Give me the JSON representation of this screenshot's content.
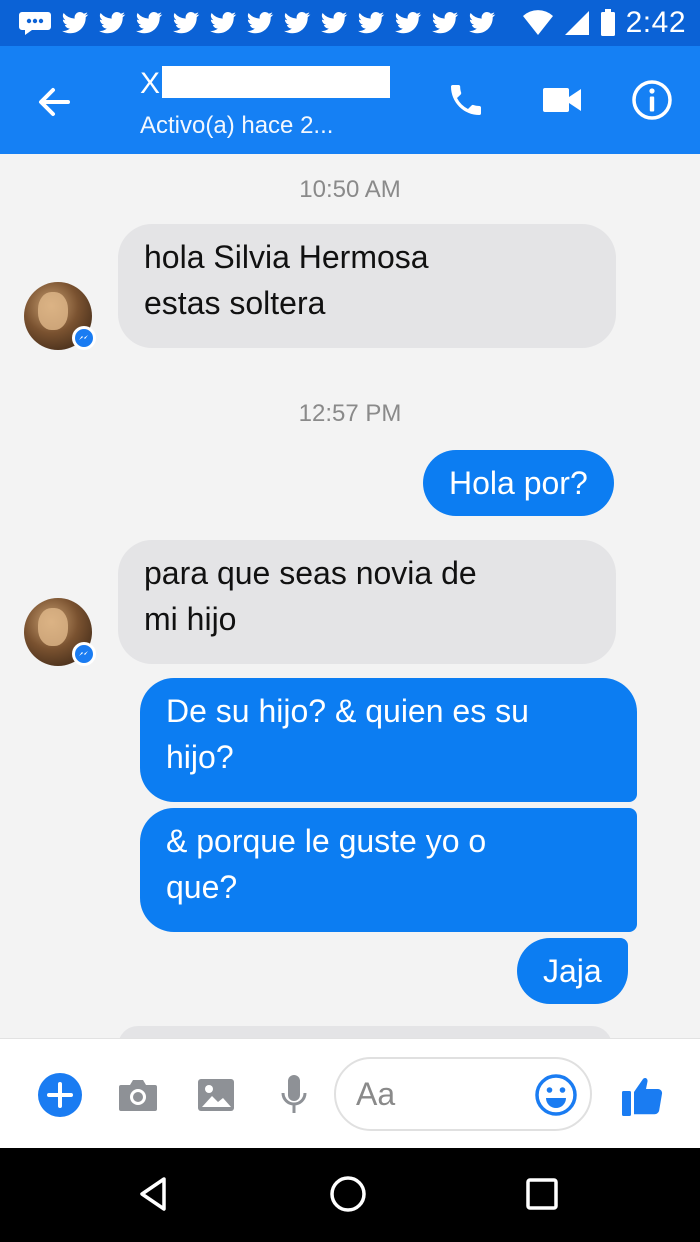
{
  "status_bar": {
    "time": "2:42",
    "notification_icons": [
      "message-notification-icon",
      "twitter-notification-icon",
      "twitter-notification-icon",
      "twitter-notification-icon",
      "twitter-notification-icon",
      "twitter-notification-icon",
      "twitter-notification-icon",
      "twitter-notification-icon",
      "twitter-notification-icon",
      "twitter-notification-icon",
      "twitter-notification-icon",
      "twitter-notification-icon"
    ],
    "system_icons": [
      "wifi-icon",
      "signal-icon",
      "battery-icon"
    ]
  },
  "header": {
    "contact_name": "X",
    "contact_status": "Activo(a) hace 2...",
    "icons": [
      "back-arrow-icon",
      "phone-icon",
      "video-camera-icon",
      "info-icon"
    ]
  },
  "messages": [
    {
      "type": "timestamp",
      "text": "10:50 AM"
    },
    {
      "type": "received",
      "lines": [
        "hola Silvia Hermosa",
        "estas soltera"
      ]
    },
    {
      "type": "timestamp",
      "text": "12:57 PM"
    },
    {
      "type": "sent",
      "lines": [
        "Hola por?"
      ]
    },
    {
      "type": "received",
      "lines": [
        "para que seas novia de",
        "mi hijo"
      ]
    },
    {
      "type": "sent",
      "lines": [
        "De su hijo? & quien es su",
        "hijo?"
      ]
    },
    {
      "type": "sent",
      "lines": [
        "& porque le guste yo o",
        "que?"
      ]
    },
    {
      "type": "sent",
      "lines": [
        "Jaja"
      ]
    }
  ],
  "composer": {
    "placeholder": "Aa",
    "icons": [
      "plus-icon",
      "camera-icon",
      "gallery-icon",
      "microphone-icon",
      "emoji-icon",
      "thumbs-up-icon"
    ]
  },
  "navigation_bar": {
    "icons": [
      "back-triangle-icon",
      "home-circle-icon",
      "recents-square-icon"
    ]
  },
  "colors": {
    "status_bar": "#0b62d6",
    "header": "#1580f4",
    "sent_bubble": "#0c7df2",
    "received_bubble": "#e4e4e6",
    "chat_background": "#f3f3f3",
    "accent": "#1a7cf2"
  }
}
